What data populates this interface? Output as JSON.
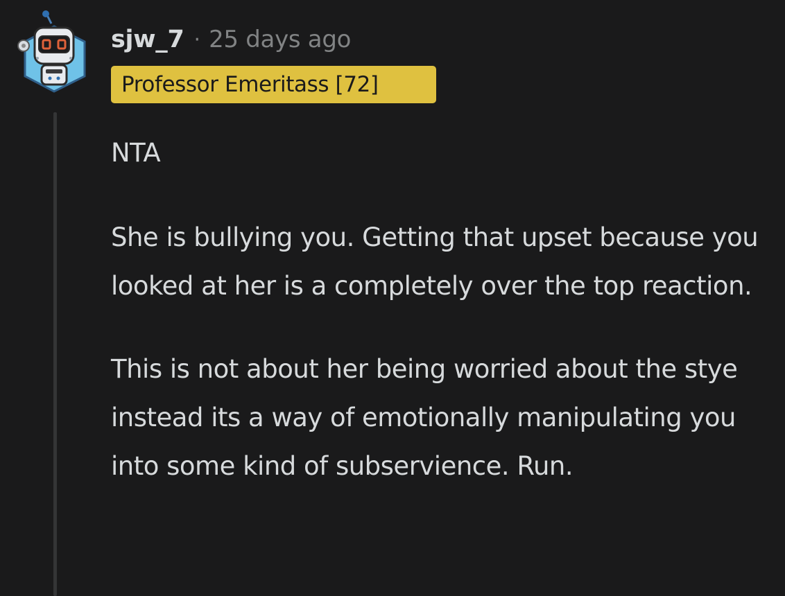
{
  "comment": {
    "username": "sjw_7",
    "separator": "·",
    "timestamp": "25 days ago",
    "flair": "Professor Emeritass [72]",
    "paragraphs": [
      "NTA",
      "She is bullying you. Getting that upset because you looked at her is a completely over the top reaction.",
      "This is not about her being worried about the stye instead its a way of emotionally manipulating you into some kind of subservience. Run."
    ]
  },
  "icons": {
    "avatar": "robot-avatar-icon"
  },
  "colors": {
    "background": "#1a1a1b",
    "text": "#d7dadc",
    "muted": "#818384",
    "flair_background": "#dfc140",
    "thread_line": "#343536"
  }
}
